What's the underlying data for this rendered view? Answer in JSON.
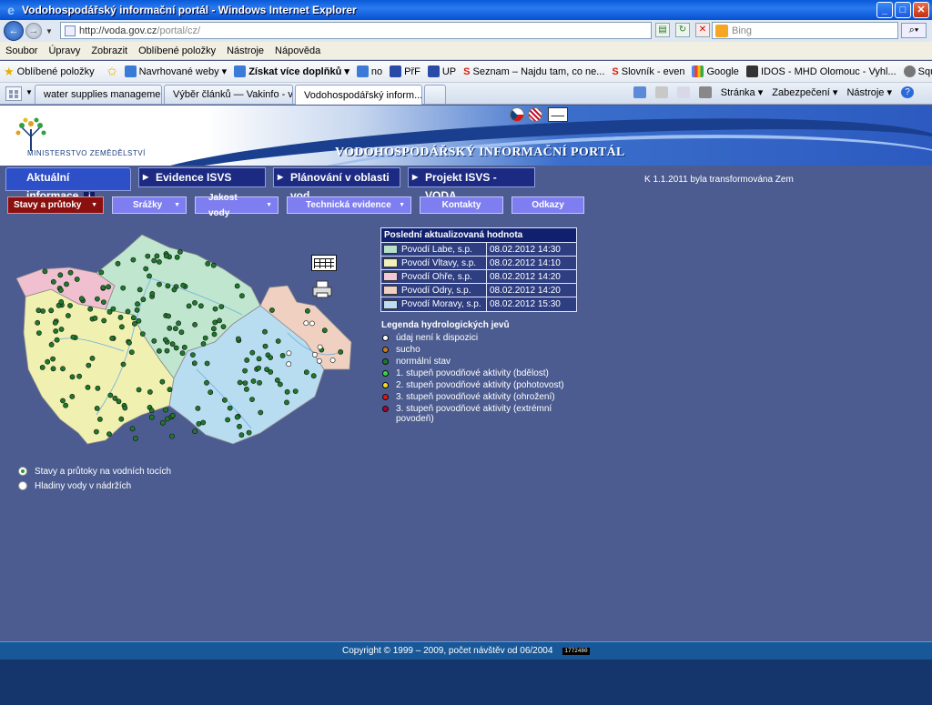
{
  "browser": {
    "window_title": "Vodohospodářský informační portál - Windows Internet Explorer",
    "url_host": "http://voda.gov.cz",
    "url_path": "/portal/cz/",
    "search_placeholder": "Bing",
    "menu": [
      "Soubor",
      "Úpravy",
      "Zobrazit",
      "Oblíbené položky",
      "Nástroje",
      "Nápověda"
    ],
    "favorites_label": "Oblíbené položky",
    "favorites": [
      {
        "label": "Navrhované weby ▾",
        "color": "#3a7ad8"
      },
      {
        "label": "Získat více doplňků ▾",
        "color": "#3a7ad8"
      },
      {
        "label": "no",
        "color": "#3a7ad8"
      },
      {
        "label": "PřF",
        "color": "#2a4aa8"
      },
      {
        "label": "UP",
        "color": "#2a4aa8"
      },
      {
        "label": "Seznam – Najdu tam, co ne...",
        "color": "#d81e05"
      },
      {
        "label": "Slovník - even",
        "color": "#d81e05"
      },
      {
        "label": "Google",
        "color": "#4a8af4"
      },
      {
        "label": "IDOS - MHD Olomouc - Vyhl...",
        "color": "#333333"
      },
      {
        "label": "SquirrelMail - Login",
        "color": "#555555"
      }
    ],
    "tabs": [
      {
        "label": "water supplies management ...",
        "color": "#2a9a3a"
      },
      {
        "label": "Výběr článků — Vakinfo - vod...",
        "color": "#3a7ad8"
      },
      {
        "label": "Vodohospodářský inform...",
        "color": "#3a7ad8"
      }
    ],
    "tab_tools": [
      "Stránka ▾",
      "Zabezpečení ▾",
      "Nástroje ▾"
    ]
  },
  "site": {
    "ministry": "MINISTERSTVO ZEMĚDĚLSTVÍ",
    "portal_title": "VODOHOSPODÁŘSKÝ INFORMAČNÍ PORTÁL",
    "main_tabs": [
      "Aktuální informace",
      "Evidence ISVS",
      "Plánování v oblasti vod",
      "Projekt ISVS - VODA"
    ],
    "info_glyph": "i",
    "notice": "K 1.1.2011 byla transformována Zem",
    "sub_tabs": [
      "Stavy a průtoky",
      "Srážky",
      "Jakost vody",
      "Technická evidence",
      "Kontakty",
      "Odkazy"
    ],
    "latest": {
      "title": "Poslední aktualizovaná hodnota",
      "rows": [
        {
          "name": "Povodí Labe, s.p.",
          "date": "08.02.2012 14:30",
          "color": "#b8e0c8"
        },
        {
          "name": "Povodí Vltavy, s.p.",
          "date": "08.02.2012 14:10",
          "color": "#f0f0b8"
        },
        {
          "name": "Povodí Ohře, s.p.",
          "date": "08.02.2012 14:20",
          "color": "#f0c8d8"
        },
        {
          "name": "Povodí Odry, s.p.",
          "date": "08.02.2012 14:20",
          "color": "#f0d0c0"
        },
        {
          "name": "Povodí Moravy, s.p.",
          "date": "08.02.2012 15:30",
          "color": "#c0dcf0"
        }
      ]
    },
    "legend": {
      "title": "Legenda hydrologických jevů",
      "items": [
        {
          "label": "údaj není k dispozici",
          "color": "#ffffff"
        },
        {
          "label": "sucho",
          "color": "#c87a20"
        },
        {
          "label": "normální stav",
          "color": "#1e7a2a"
        },
        {
          "label": "1. stupeň povodňové aktivity (bdělost)",
          "color": "#3ad83a"
        },
        {
          "label": "2. stupeň povodňové aktivity (pohotovost)",
          "color": "#f0e020"
        },
        {
          "label": "3. stupeň povodňové aktivity (ohrožení)",
          "color": "#d81a1a"
        },
        {
          "label": "3. stupeň povodňové aktivity (extrémní povodeň)",
          "color": "#b00030"
        }
      ]
    },
    "radios": [
      {
        "label": "Stavy a průtoky na vodních tocích",
        "checked": true
      },
      {
        "label": "Hladiny vody v nádržích",
        "checked": false
      }
    ],
    "footer": "Copyright © 1999 – 2009, počet návštěv od 06/2004",
    "counter": "1772480"
  }
}
